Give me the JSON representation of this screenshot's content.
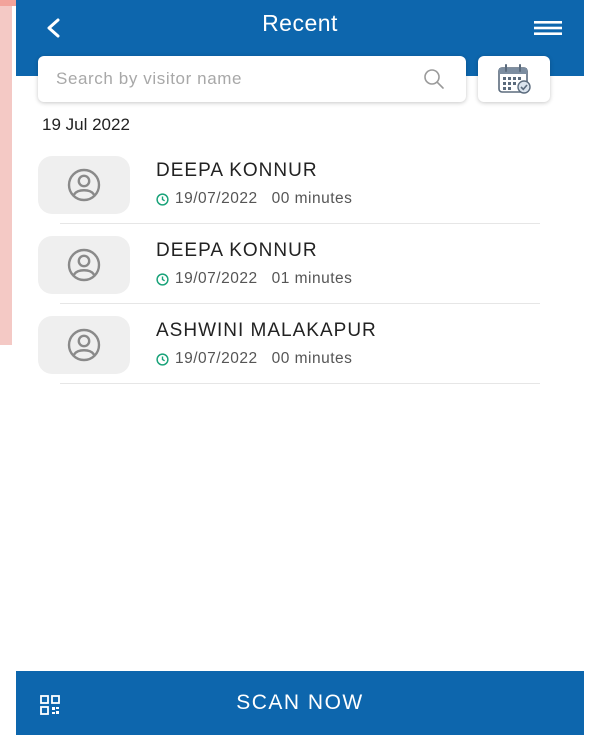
{
  "header": {
    "title": "Recent",
    "back_icon": "chevron-left-icon",
    "menu_icon": "menu-icon"
  },
  "search": {
    "placeholder": "Search by visitor name",
    "value": "",
    "icon": "search-icon"
  },
  "calendar_icon": "calendar-icon",
  "date_group": "19 Jul 2022",
  "visits": [
    {
      "name": "DEEPA KONNUR",
      "date": "19/07/2022",
      "duration": "00 minutes"
    },
    {
      "name": "DEEPA KONNUR",
      "date": "19/07/2022",
      "duration": "01 minutes"
    },
    {
      "name": "ASHWINI MALAKAPUR",
      "date": "19/07/2022",
      "duration": "00 minutes"
    }
  ],
  "bottom_bar": {
    "label": "SCAN NOW",
    "icon": "qr-code-icon"
  },
  "colors": {
    "primary": "#0d66ad",
    "clock": "#1aa37a",
    "avatar_bg": "#efefef"
  }
}
